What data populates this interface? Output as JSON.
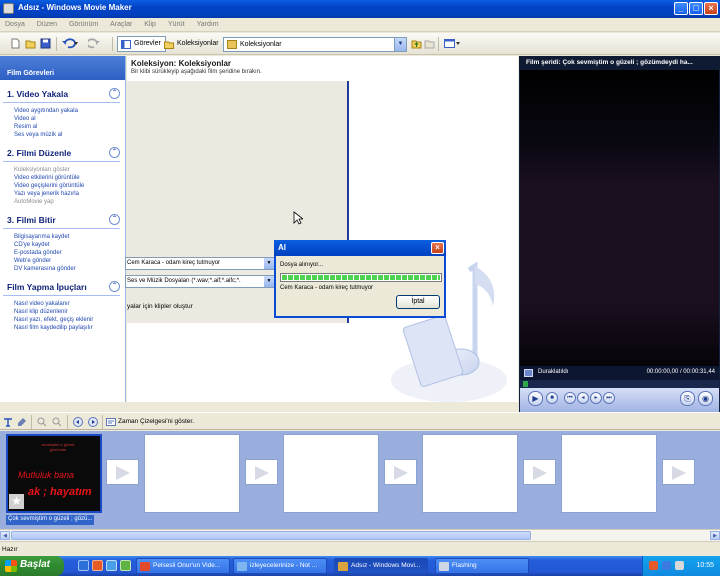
{
  "window": {
    "title": "Adsız - Windows Movie Maker",
    "min_label": "_",
    "max_label": "□",
    "close_label": "×"
  },
  "menu": [
    "Dosya",
    "Düzen",
    "Görünüm",
    "Araçlar",
    "Klip",
    "Yürüt",
    "Yardım"
  ],
  "toolbar": {
    "tasks_label": "Görevler",
    "collections_label": "Koleksiyonlar",
    "collection_combo_value": "Koleksiyonlar"
  },
  "tasks_pane": {
    "header": "Film Görevleri",
    "sections": [
      {
        "title": "1. Video Yakala",
        "items": [
          {
            "label": "Video aygıtından yakala",
            "enabled": true
          },
          {
            "label": "Video al",
            "enabled": true
          },
          {
            "label": "Resim al",
            "enabled": true
          },
          {
            "label": "Ses veya müzik al",
            "enabled": true
          }
        ]
      },
      {
        "title": "2. Filmi Düzenle",
        "items": [
          {
            "label": "Koleksiyonları göster",
            "enabled": false
          },
          {
            "label": "Video etkilerini görüntüle",
            "enabled": true
          },
          {
            "label": "Video geçişlerini görüntüle",
            "enabled": true
          },
          {
            "label": "Yazı veya jenerik hazırla",
            "enabled": true
          },
          {
            "label": "AutoMovie yap",
            "enabled": false
          }
        ]
      },
      {
        "title": "3. Filmi Bitir",
        "items": [
          {
            "label": "Bilgisayarıma kaydet",
            "enabled": true
          },
          {
            "label": "CD'ye kaydet",
            "enabled": true
          },
          {
            "label": "E-postada gönder",
            "enabled": true
          },
          {
            "label": "Web'e gönder",
            "enabled": true
          },
          {
            "label": "DV kamerasına gönder",
            "enabled": true
          }
        ]
      },
      {
        "title": "Film Yapma İpuçları",
        "items": [
          {
            "label": "Nasıl video yakalanır",
            "enabled": true
          },
          {
            "label": "Nasıl klip düzenlenir",
            "enabled": true
          },
          {
            "label": "Nasıl yazı, efekt, geçiş eklenir",
            "enabled": true
          },
          {
            "label": "Nasıl film kaydedilip paylaşılır",
            "enabled": true
          }
        ]
      }
    ]
  },
  "collections": {
    "title": "Koleksiyon: Koleksiyonlar",
    "subtitle": "Bir klibi sürükleyip aşağıdaki film şeridine bırakın."
  },
  "import_dialog": {
    "filename_value": "Cem Karaca - odam kireç tutmuyor",
    "filetype_value": "Ses ve Müzik Dosyaları (*.wav;*.aif;*.aifc;*.",
    "option_label": "yalar için klipler oluştur"
  },
  "progress_dialog": {
    "title": "Al",
    "status": "Dosya alınıyor...",
    "filename": "Cem Karaca - odam kireç tutmuyor",
    "progress": 1.0,
    "cancel_label": "İptal"
  },
  "monitor": {
    "title": "Film şeridi: Çok sevmiştim o güzeli ; gözümdeydi ha...",
    "state": "Duraklatıldı",
    "time": "00:00:00,00 / 00:00:31,44",
    "seek_position": 0.0
  },
  "storyboard": {
    "toggle_label": "Zaman Çizelgesi'ni göster.",
    "clip": {
      "caption": "Çok sevmiştim o güzeli ; gözü...",
      "thumb_top": "sevmiştim o güzeli gözümde",
      "thumb_mid": "Mutluluk bana",
      "thumb_bot": "ak ; hayatım"
    }
  },
  "statusbar": {
    "text": "Hazır"
  },
  "taskbar": {
    "start_label": "Başlat",
    "buttons": [
      {
        "label": "Pelsesli Onur'un Vide...",
        "active": false,
        "color": "#e24a2b"
      },
      {
        "label": "izleyecelerinize - Not ...",
        "active": false,
        "color": "#7fb5f0"
      },
      {
        "label": "Adsız - Windows Movi...",
        "active": true,
        "color": "#d9a43b"
      },
      {
        "label": "Flashing",
        "active": false,
        "color": "#cfd6e6"
      }
    ],
    "clock": "10:55"
  },
  "colors": {
    "xp_blue": "#0040c0",
    "tasks_link": "#2148b0",
    "progress_green": "#4fd24f",
    "start_green": "#2f8a2f",
    "clip_text_red": "#e8141a"
  }
}
